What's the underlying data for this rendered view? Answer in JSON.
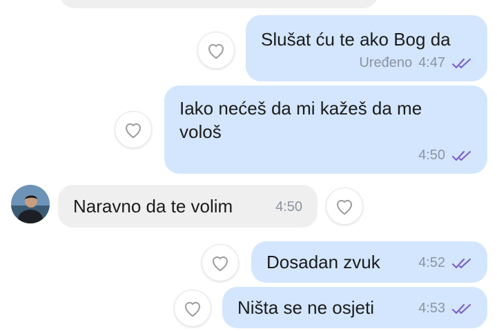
{
  "messages": [
    {
      "text": "Slušat ću te ako Bog da",
      "edited_label": "Uređeno",
      "time": "4:47",
      "status_icon": "double-check-icon"
    },
    {
      "text_line1": "Iako nećeš da mi kažeš da me",
      "text_line2": "vološ",
      "time": "4:50",
      "status_icon": "double-check-icon"
    },
    {
      "text": "Naravno da te volim",
      "time": "4:50"
    },
    {
      "text": "Dosadan zvuk",
      "time": "4:52",
      "status_icon": "double-check-icon"
    },
    {
      "text": "Ništa se ne osjeti",
      "time": "4:53",
      "status_icon": "double-check-icon"
    }
  ],
  "icons": {
    "reaction": "heart-outline-icon",
    "read_receipt": "double-check-icon"
  },
  "colors": {
    "outgoing_bubble": "#d3e6fd",
    "incoming_bubble": "#efefef",
    "check": "#7b61c8",
    "meta_text": "#8c93a0"
  }
}
